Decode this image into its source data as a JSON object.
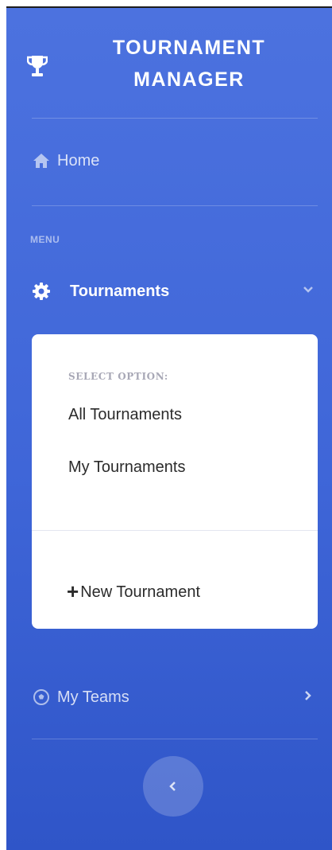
{
  "brand": {
    "line1": "TOURNAMENT",
    "line2": "MANAGER",
    "icon": "trophy-icon"
  },
  "nav": {
    "home": {
      "label": "Home",
      "icon": "home-icon"
    },
    "heading": "MENU",
    "tournaments": {
      "label": "Tournaments",
      "icon": "cog-icon",
      "expanded": true,
      "panel": {
        "header": "SELECT OPTION:",
        "items": [
          "All Tournaments",
          "My Tournaments"
        ],
        "new_label": "New Tournament"
      }
    },
    "teams": {
      "label": "My Teams",
      "icon": "football-icon"
    }
  },
  "colors": {
    "sidebar_top": "#4c72df",
    "sidebar_bottom": "#2f55c8",
    "panel_bg": "#ffffff",
    "panel_header": "#a8a8b6"
  }
}
